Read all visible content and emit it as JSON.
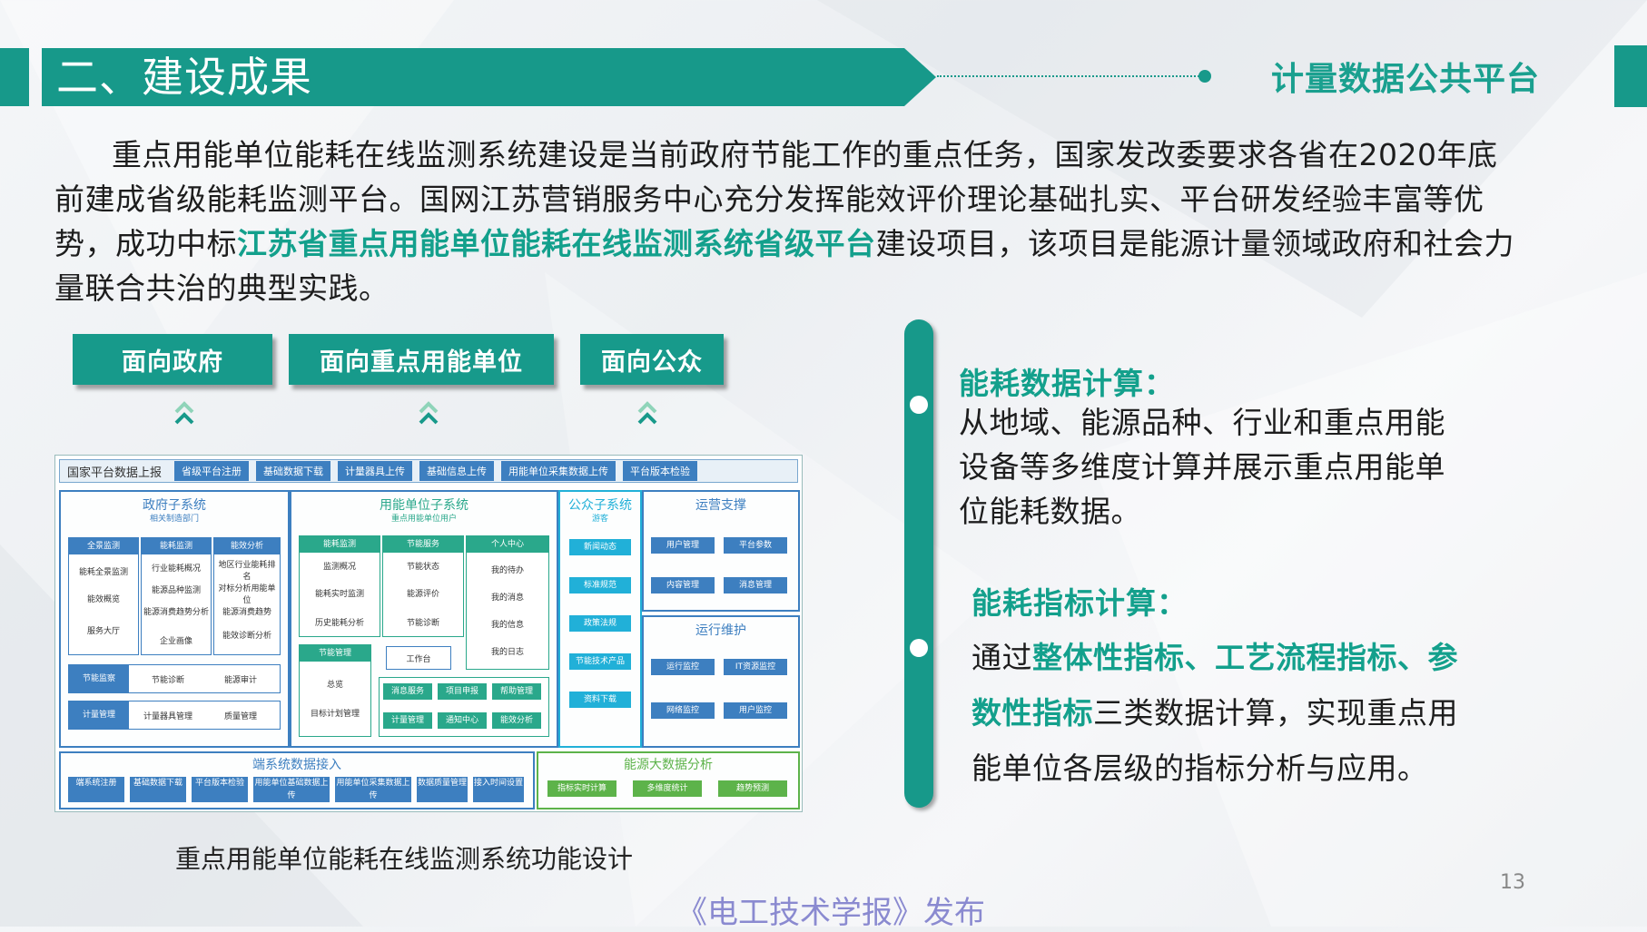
{
  "header": {
    "section_title": "二、建设成果",
    "brand": "计量数据公共平台"
  },
  "intro": {
    "part1": "重点用能单位能耗在线监测系统建设是当前政府节能工作的重点任务，国家发改委要求各省在2020年底前建成省级能耗监测平台。国网江苏营销服务中心充分发挥能效评价理论基础扎实、平台研发经验丰富等优势，成功中标",
    "highlight": "江苏省重点用能单位能耗在线监测系统省级平台",
    "part2": "建设项目，该项目是能源计量领域政府和社会力量联合共治的典型实践。"
  },
  "facets": [
    "面向政府",
    "面向重点用能单位",
    "面向公众"
  ],
  "diagram": {
    "top_label": "国家平台数据上报",
    "top_tabs": [
      "省级平台注册",
      "基础数据下载",
      "计量器具上传",
      "基础信息上传",
      "用能单位采集数据上传",
      "平台版本检验"
    ],
    "gov": {
      "title": "政府子系统",
      "sub": "相关制造部门",
      "cols": [
        {
          "head": "全景监测",
          "items": [
            "能耗全景监测",
            "能效概览",
            "服务大厅"
          ]
        },
        {
          "head": "能耗监测",
          "items": [
            "行业能耗概况",
            "能源品种监测",
            "能源消费趋势分析",
            "企业画像"
          ]
        },
        {
          "head": "能效分析",
          "items": [
            "地区行业能耗排名",
            "对标分析用能单位",
            "能源消费趋势",
            "能效诊断分析"
          ]
        }
      ],
      "row1": [
        "节能监察",
        "节能诊断",
        "能源审计"
      ],
      "row2": [
        "计量管理",
        "计量器具管理",
        "质量管理"
      ]
    },
    "unit": {
      "title": "用能单位子系统",
      "sub": "重点用能单位用户",
      "cols": [
        {
          "head": "能耗监测",
          "items": [
            "监测概况",
            "能耗实时监测",
            "历史能耗分析"
          ]
        },
        {
          "head": "节能服务",
          "items": [
            "节能状态",
            "能源评价",
            "节能诊断"
          ]
        },
        {
          "head": "个人中心",
          "items": [
            "我的待办",
            "我的消息",
            "我的信息",
            "我的日志"
          ]
        }
      ],
      "plan_head": "节能管理",
      "plan_items": [
        "总览",
        "目标计划管理"
      ],
      "work": "工作台",
      "bottom": [
        "消息服务",
        "项目申报",
        "帮助管理",
        "计量管理",
        "通知中心",
        "能效分析"
      ]
    },
    "public": {
      "title": "公众子系统",
      "sub": "游客",
      "items": [
        "新闻动态",
        "标准规范",
        "政策法规",
        "节能技术产品",
        "资料下载"
      ]
    },
    "ops": {
      "title": "运营支撑",
      "items": [
        "用户管理",
        "平台参数",
        "内容管理",
        "消息管理"
      ]
    },
    "maint": {
      "title": "运行维护",
      "items": [
        "运行监控",
        "IT资源监控",
        "网络监控",
        "用户监控"
      ]
    },
    "access": {
      "title": "端系统数据接入",
      "items": [
        "端系统注册",
        "基础数据下载",
        "平台版本检验",
        "用能单位基础数据上传",
        "用能单位采集数据上传",
        "数据质量管理",
        "接入时间设置"
      ]
    },
    "bigdata": {
      "title": "能源大数据分析",
      "items": [
        "指标实时计算",
        "多维度统计",
        "趋势预测"
      ]
    }
  },
  "caption": "重点用能单位能耗在线监测系统功能设计",
  "sections": {
    "s1_head": "能耗数据计算：",
    "s1_body": "从地域、能源品种、行业和重点用能设备等多维度计算并展示重点用能单位能耗数据。",
    "s2_head": "能耗指标计算：",
    "s2_pre": "通过",
    "s2_hl": "整体性指标、工艺流程指标、参数性指标",
    "s2_post": "三类数据计算，实现重点用能单位各层级的指标分析与应用。"
  },
  "page_number": "13",
  "source": "《电工技术学报》发布",
  "colors": {
    "accent": "#17998a",
    "highlight": "#13a08c",
    "diagram_blue": "#3d7fc0"
  }
}
